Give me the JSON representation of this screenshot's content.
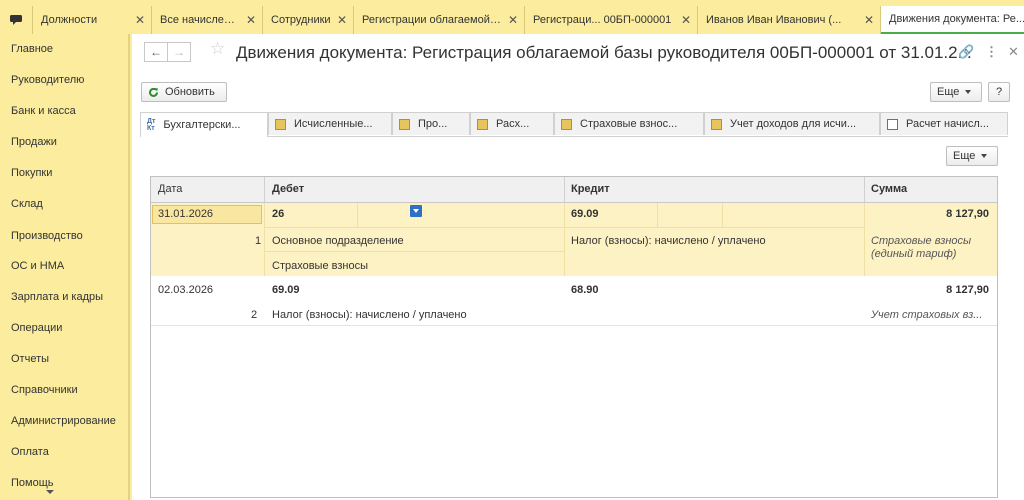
{
  "tabs": [
    {
      "label": "Должности"
    },
    {
      "label": "Все начисления"
    },
    {
      "label": "Сотрудники"
    },
    {
      "label": "Регистрации облагаемой ..."
    },
    {
      "label": "Регистраци... 00БП-000001"
    },
    {
      "label": "Иванов Иван Иванович (..."
    },
    {
      "label": "Движения документа: Ре..."
    }
  ],
  "sidebar": {
    "items": [
      {
        "label": "Главное"
      },
      {
        "label": "Руководителю"
      },
      {
        "label": "Банк и касса"
      },
      {
        "label": "Продажи"
      },
      {
        "label": "Покупки"
      },
      {
        "label": "Склад"
      },
      {
        "label": "Производство"
      },
      {
        "label": "ОС и НМА"
      },
      {
        "label": "Зарплата и кадры"
      },
      {
        "label": "Операции"
      },
      {
        "label": "Отчеты"
      },
      {
        "label": "Справочники"
      },
      {
        "label": "Администрирование"
      },
      {
        "label": "Оплата"
      },
      {
        "label": "Помощь"
      }
    ]
  },
  "header": {
    "title": "Движения документа: Регистрация облагаемой базы руководителя 00БП-000001 от 31.01.2..."
  },
  "toolbar": {
    "refresh_label": "Обновить",
    "more_label": "Еще",
    "help_label": "?"
  },
  "doc_tabs": [
    {
      "label": "Бухгалтерски...",
      "icon": "dt-kt-icon"
    },
    {
      "label": "Исчисленные...",
      "icon": "register-icon"
    },
    {
      "label": "Про...",
      "icon": "register-icon"
    },
    {
      "label": "Расх...",
      "icon": "register-icon"
    },
    {
      "label": "Страховые взнос...",
      "icon": "register-icon"
    },
    {
      "label": "Учет доходов для исчи...",
      "icon": "register-icon"
    },
    {
      "label": "Расчет начисл...",
      "icon": "grid-icon"
    }
  ],
  "table": {
    "more_label": "Еще",
    "headers": {
      "date": "Дата",
      "debit": "Дебет",
      "credit": "Кредит",
      "sum": "Сумма"
    },
    "rows": [
      {
        "date": "31.01.2026",
        "num": "1",
        "debit": "26",
        "debit_sub1": "Основное подразделение",
        "debit_sub2": "Страховые взносы",
        "credit": "69.09",
        "credit_sub1": "Налог (взносы): начислено / уплачено",
        "sum": "8 127,90",
        "content": "Страховые взносы (единый тариф)"
      },
      {
        "date": "02.03.2026",
        "num": "2",
        "debit": "69.09",
        "debit_sub1": "Налог (взносы): начислено / уплачено",
        "credit": "68.90",
        "sum": "8 127,90",
        "content": "Учет страховых вз..."
      }
    ]
  },
  "colors": {
    "sidebar_bg": "#fbec9e",
    "selected_row": "#fdf2c4",
    "active_tab_underline": "#4caa4c"
  }
}
